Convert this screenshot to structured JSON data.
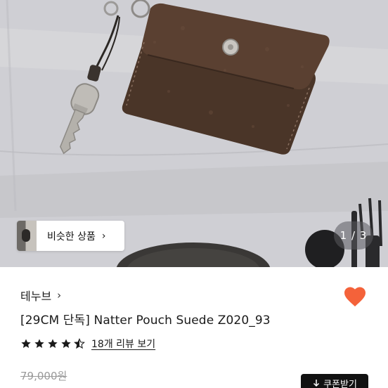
{
  "hero": {
    "similar_label": "비슷한 상품",
    "similar_chevron": "›",
    "counter": "1 / 3"
  },
  "product": {
    "brand": "테누브",
    "brand_chevron": "›",
    "title": "[29CM 단독] Natter Pouch Suede Z020_93",
    "rating": 4.5,
    "reviews_label": "18개 리뷰 보기",
    "original_price": "79,000원",
    "liked": true
  },
  "actions": {
    "coupon_label": "쿠폰받기",
    "coupon_icon": "download-arrow-icon"
  },
  "colors": {
    "heart": "#f4623a",
    "coupon_bg": "#111111",
    "star": "#1a1a1a"
  }
}
